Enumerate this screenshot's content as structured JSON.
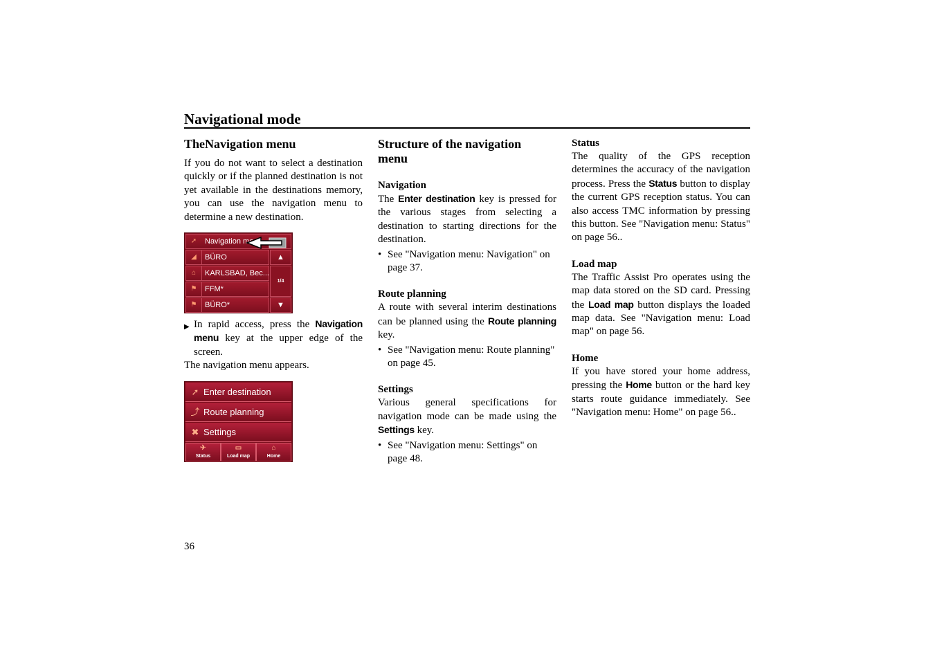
{
  "header": {
    "title": "Navigational mode"
  },
  "page_number": "36",
  "col1": {
    "heading": "TheNavigation menu",
    "intro": "If you do not want to select a destination quickly or if the planned destination is not yet available in the destinations memory, you can use the navigation menu to determine a new destination.",
    "screen1": {
      "title_button": "Navigation menu",
      "page_indicator": "1/4",
      "items": [
        {
          "icon": "blank-icon",
          "label": "BÜRO"
        },
        {
          "icon": "home-icon",
          "label": "KARLSBAD, Bec..."
        },
        {
          "icon": "flag-icon",
          "label": "FFM*"
        },
        {
          "icon": "flag-icon",
          "label": "BÜRO*"
        }
      ],
      "scroll_up": "▲",
      "scroll_down": "▼"
    },
    "step": {
      "before": "In rapid access, press the ",
      "key": "Navigation menu",
      "after": " key at the upper edge of the screen."
    },
    "result": "The navigation menu appears.",
    "screen2": {
      "buttons": [
        {
          "icon": "compass-icon",
          "label": "Enter destination"
        },
        {
          "icon": "route-icon",
          "label": "Route planning"
        },
        {
          "icon": "tools-icon",
          "label": "Settings"
        }
      ],
      "small_buttons": [
        {
          "icon": "satellite-icon",
          "label": "Status"
        },
        {
          "icon": "map-icon",
          "label": "Load map"
        },
        {
          "icon": "home-icon",
          "label": "Home"
        }
      ]
    }
  },
  "col2": {
    "heading": "Structure of the navigation menu",
    "sections": [
      {
        "title": "Navigation",
        "text_before": "The ",
        "key": "Enter destination",
        "text_after": " key is pressed for the various stages from selecting a destination to starting directions for the destination.",
        "bullet": "See \"Navigation menu: Navigation\" on page 37."
      },
      {
        "title": "Route planning",
        "text_before": "A route with several interim destinations can be planned using the ",
        "key": "Route planning",
        "text_after": " key.",
        "bullet": "See \"Navigation menu: Route planning\" on page 45."
      },
      {
        "title": "Settings",
        "text_before": "Various general specifications for navigation mode can be made using the ",
        "key": "Settings",
        "text_after": " key.",
        "bullet": "See \"Navigation menu: Settings\" on page 48."
      }
    ]
  },
  "col3": {
    "sections": [
      {
        "title": "Status",
        "text_before": "The quality of the GPS reception determines the accuracy of the navigation process. Press the ",
        "key": "Status",
        "text_after": " button to display the current GPS reception status. You can also access TMC information by pressing this button. See \"Navigation menu: Status\" on page 56.."
      },
      {
        "title": "Load map",
        "text_before": "The Traffic Assist Pro operates using the map data stored on the SD card. Pressing the ",
        "key": "Load map",
        "text_after": " button displays the loaded map data. See \"Navigation menu: Load map\" on page 56."
      },
      {
        "title": "Home",
        "text_before": "If you have stored your home address, pressing the ",
        "key": "Home",
        "text_after": " button or the hard key starts route guidance immediately. See \"Navigation menu: Home\" on page 56.."
      }
    ]
  },
  "colors": {
    "menu_red": "#7a0e1c",
    "menu_highlight": "#b3203a",
    "icon_orange": "#ff9a70"
  }
}
